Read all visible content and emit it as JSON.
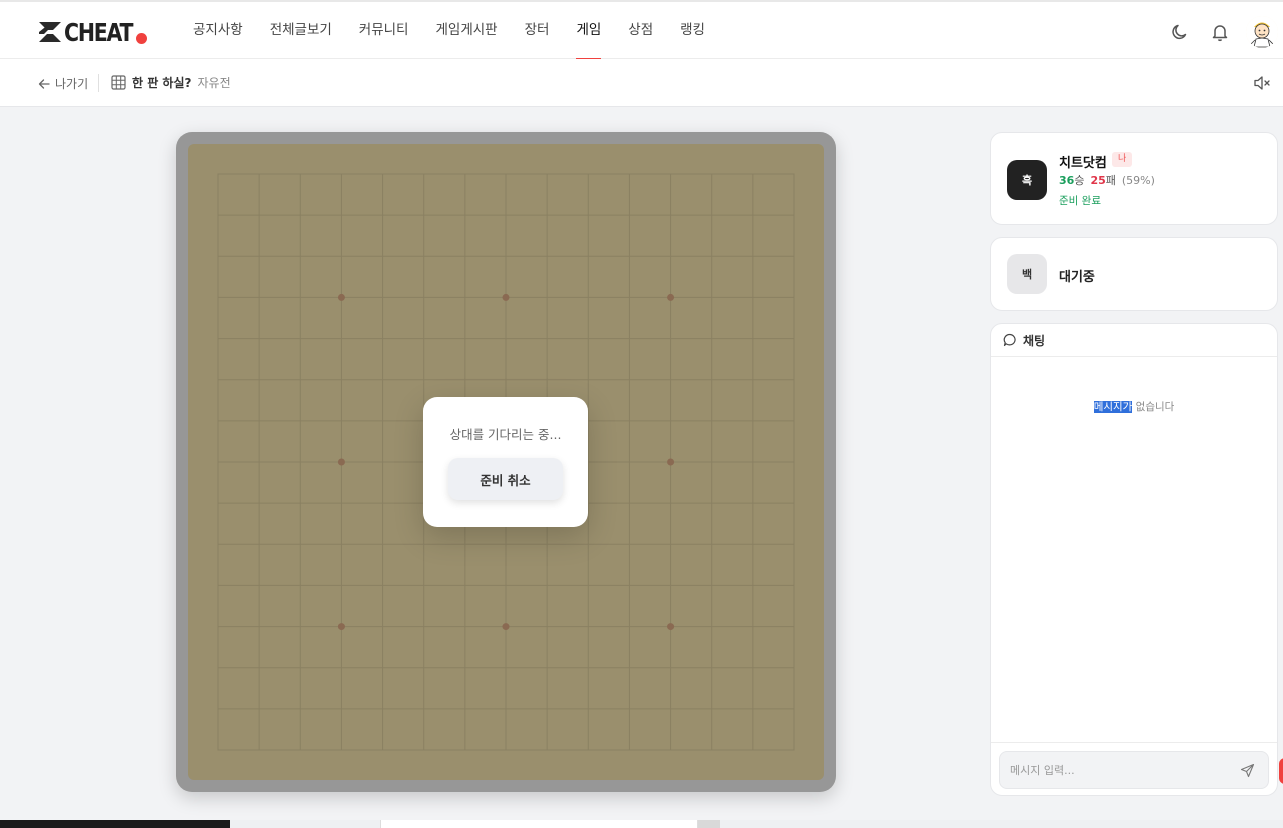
{
  "header": {
    "logo_text": "CHEAT",
    "nav": [
      {
        "label": "공지사항",
        "active": false
      },
      {
        "label": "전체글보기",
        "active": false
      },
      {
        "label": "커뮤니티",
        "active": false
      },
      {
        "label": "게임게시판",
        "active": false
      },
      {
        "label": "장터",
        "active": false
      },
      {
        "label": "게임",
        "active": true
      },
      {
        "label": "상점",
        "active": false
      },
      {
        "label": "랭킹",
        "active": false
      }
    ],
    "icons": [
      "moon-icon",
      "bell-icon",
      "avatar"
    ]
  },
  "subbar": {
    "back_label": "나가기",
    "game_title": "한 판 하실?",
    "game_mode": "자유전",
    "icons": [
      "grid-icon",
      "speaker-muted-icon"
    ]
  },
  "board": {
    "size": 15,
    "star_points": [
      [
        3,
        3
      ],
      [
        7,
        3
      ],
      [
        11,
        3
      ],
      [
        3,
        7
      ],
      [
        11,
        7
      ],
      [
        3,
        11
      ],
      [
        7,
        11
      ],
      [
        11,
        11
      ]
    ],
    "dialog": {
      "message": "상대를 기다리는 중...",
      "button_label": "준비 취소"
    }
  },
  "players": [
    {
      "stone": "흑",
      "name": "치트닷컴",
      "me_tag": "나",
      "wins": "36",
      "win_unit": "승",
      "losses": "25",
      "loss_unit": "패",
      "rate": "(59%)",
      "status": "준비 완료"
    },
    {
      "stone": "백",
      "status": "대기중"
    }
  ],
  "chat": {
    "title": "채팅",
    "empty_highlight": "메시지가",
    "empty_rest": " 없습니다",
    "input_placeholder": "메시지 입력..."
  },
  "colors": {
    "accent": "#f0413e",
    "win": "#1a9e5c",
    "loss": "#e0364a",
    "board_wood": "#9a8f6d",
    "board_frame": "#979797"
  }
}
